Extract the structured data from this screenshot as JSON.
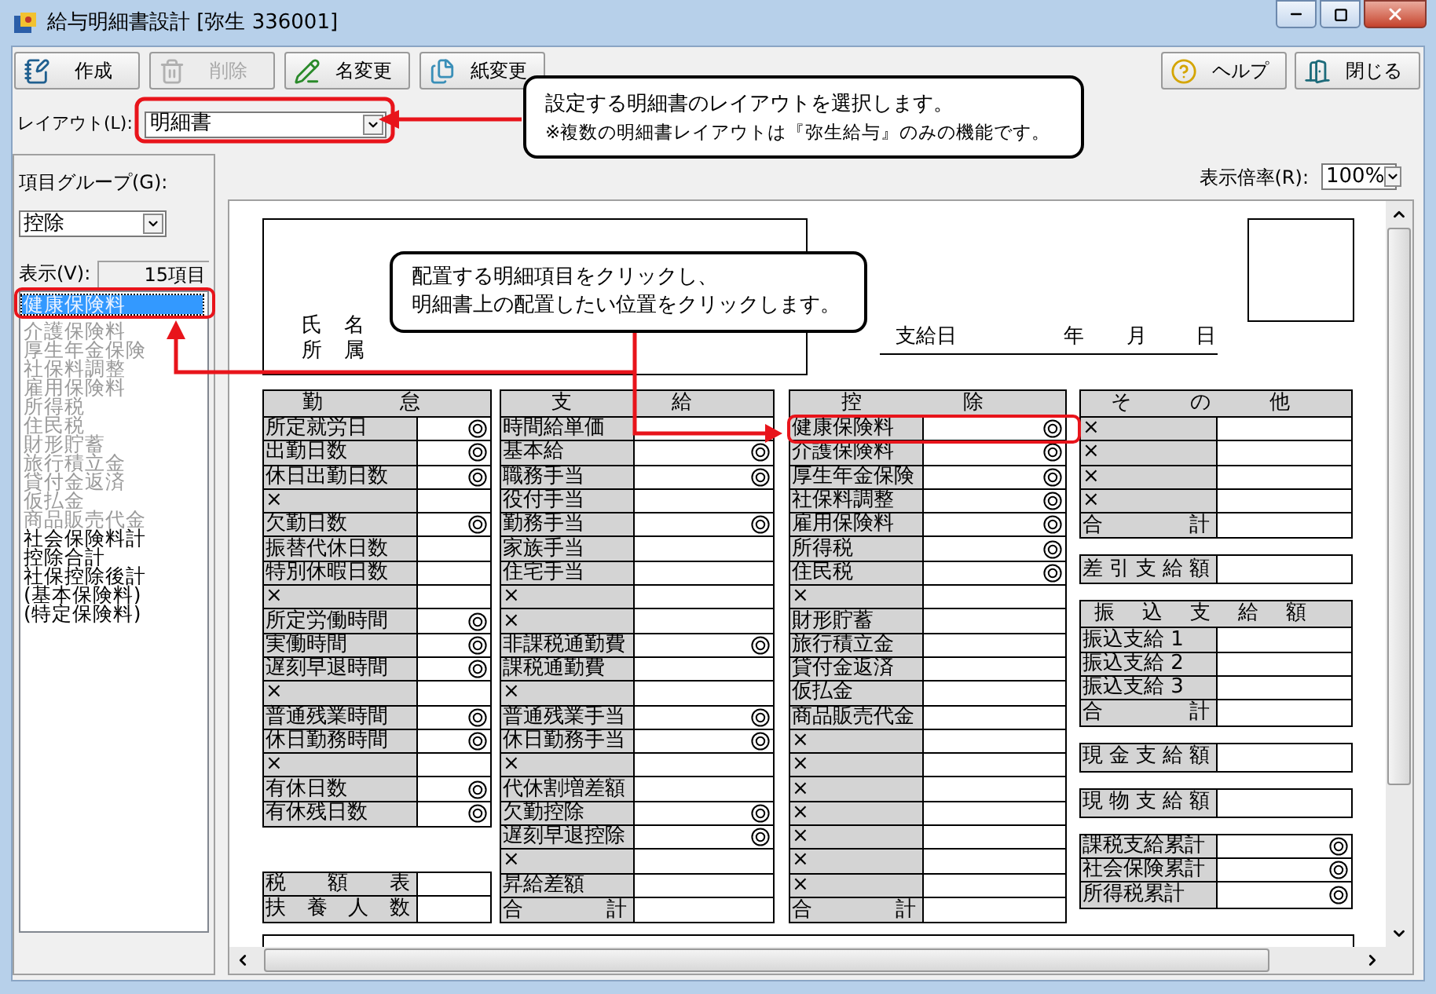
{
  "window": {
    "title": "給与明細書設計 [弥生 336001]"
  },
  "toolbar": {
    "left": [
      {
        "label": "作成",
        "disabled": false
      },
      {
        "label": "削除",
        "disabled": true
      },
      {
        "label": "名変更",
        "disabled": false
      },
      {
        "label": "紙変更",
        "disabled": false
      }
    ],
    "right": [
      {
        "label": "ヘルプ",
        "disabled": false
      },
      {
        "label": "閉じる",
        "disabled": false
      }
    ]
  },
  "layout": {
    "label": "レイアウト(L):",
    "value": "明細書"
  },
  "item_group": {
    "label": "項目グループ(G):",
    "value": "控除"
  },
  "view": {
    "label": "表示(V):",
    "count": "15項目"
  },
  "items": [
    {
      "label": "健康保険料",
      "selected": true,
      "placed": true
    },
    {
      "label": "介護保険料",
      "selected": false,
      "placed": true
    },
    {
      "label": "厚生年金保険",
      "selected": false,
      "placed": true
    },
    {
      "label": "社保料調整",
      "selected": false,
      "placed": true
    },
    {
      "label": "雇用保険料",
      "selected": false,
      "placed": true
    },
    {
      "label": "所得税",
      "selected": false,
      "placed": true
    },
    {
      "label": "住民税",
      "selected": false,
      "placed": true
    },
    {
      "label": "財形貯蓄",
      "selected": false,
      "placed": true
    },
    {
      "label": "旅行積立金",
      "selected": false,
      "placed": true
    },
    {
      "label": "貸付金返済",
      "selected": false,
      "placed": true
    },
    {
      "label": "仮払金",
      "selected": false,
      "placed": true
    },
    {
      "label": "商品販売代金",
      "selected": false,
      "placed": true
    },
    {
      "label": "社会保険料計",
      "selected": false,
      "placed": false
    },
    {
      "label": "控除合計",
      "selected": false,
      "placed": false
    },
    {
      "label": "社保控除後計",
      "selected": false,
      "placed": false
    },
    {
      "label": "(基本保険料)",
      "selected": false,
      "placed": false
    },
    {
      "label": "(特定保険料)",
      "selected": false,
      "placed": false
    }
  ],
  "zoom": {
    "label": "表示倍率(R):",
    "value": "100%"
  },
  "form": {
    "name_label": "氏 名",
    "dept_label": "所 属",
    "pay_date": {
      "label": "支給日",
      "year": "年",
      "month": "月",
      "day": "日"
    },
    "columns": [
      {
        "tables": [
          {
            "header": "勤 怠",
            "rows": [
              {
                "label": "所定就労日",
                "spread": false,
                "marked": true
              },
              {
                "label": "出勤日数",
                "spread": false,
                "marked": true
              },
              {
                "label": "休日出勤日数",
                "spread": false,
                "marked": true
              },
              {
                "label": "×",
                "spread": false,
                "marked": false
              },
              {
                "label": "欠勤日数",
                "spread": false,
                "marked": true
              },
              {
                "label": "振替代休日数",
                "spread": false,
                "marked": false
              },
              {
                "label": "特別休暇日数",
                "spread": false,
                "marked": false
              },
              {
                "label": "×",
                "spread": false,
                "marked": false
              },
              {
                "label": "所定労働時間",
                "spread": false,
                "marked": true
              },
              {
                "label": "実働時間",
                "spread": false,
                "marked": true
              },
              {
                "label": "遅刻早退時間",
                "spread": false,
                "marked": true
              },
              {
                "label": "×",
                "spread": false,
                "marked": false
              },
              {
                "label": "普通残業時間",
                "spread": false,
                "marked": true
              },
              {
                "label": "休日勤務時間",
                "spread": false,
                "marked": true
              },
              {
                "label": "×",
                "spread": false,
                "marked": false
              },
              {
                "label": "有休日数",
                "spread": false,
                "marked": true
              },
              {
                "label": "有休残日数",
                "spread": false,
                "marked": true
              }
            ]
          },
          {
            "rows": [
              {
                "label": "税 額 表",
                "spread": true,
                "marked": false
              },
              {
                "label": "扶 養 人 数",
                "spread": true,
                "marked": false
              }
            ]
          }
        ]
      },
      {
        "tables": [
          {
            "header": "支 給",
            "rows": [
              {
                "label": "時間給単価",
                "spread": false,
                "marked": false
              },
              {
                "label": "基本給",
                "spread": false,
                "marked": true
              },
              {
                "label": "職務手当",
                "spread": false,
                "marked": true
              },
              {
                "label": "役付手当",
                "spread": false,
                "marked": false
              },
              {
                "label": "勤務手当",
                "spread": false,
                "marked": true
              },
              {
                "label": "家族手当",
                "spread": false,
                "marked": false
              },
              {
                "label": "住宅手当",
                "spread": false,
                "marked": false
              },
              {
                "label": "×",
                "spread": false,
                "marked": false
              },
              {
                "label": "×",
                "spread": false,
                "marked": false
              },
              {
                "label": "非課税通勤費",
                "spread": false,
                "marked": true
              },
              {
                "label": "課税通勤費",
                "spread": false,
                "marked": false
              },
              {
                "label": "×",
                "spread": false,
                "marked": false
              },
              {
                "label": "普通残業手当",
                "spread": false,
                "marked": true
              },
              {
                "label": "休日勤務手当",
                "spread": false,
                "marked": true
              },
              {
                "label": "×",
                "spread": false,
                "marked": false
              },
              {
                "label": "代休割増差額",
                "spread": false,
                "marked": false
              },
              {
                "label": "欠勤控除",
                "spread": false,
                "marked": true
              },
              {
                "label": "遅刻早退控除",
                "spread": false,
                "marked": true
              },
              {
                "label": "×",
                "spread": false,
                "marked": false
              },
              {
                "label": "昇給差額",
                "spread": false,
                "marked": false
              },
              {
                "label": "合 計",
                "spread": true,
                "marked": false
              }
            ]
          }
        ]
      },
      {
        "tables": [
          {
            "header": "控 除",
            "rows": [
              {
                "label": "健康保険料",
                "spread": false,
                "marked": true
              },
              {
                "label": "介護保険料",
                "spread": false,
                "marked": true
              },
              {
                "label": "厚生年金保険",
                "spread": false,
                "marked": true
              },
              {
                "label": "社保料調整",
                "spread": false,
                "marked": true
              },
              {
                "label": "雇用保険料",
                "spread": false,
                "marked": true
              },
              {
                "label": "所得税",
                "spread": false,
                "marked": true
              },
              {
                "label": "住民税",
                "spread": false,
                "marked": true
              },
              {
                "label": "×",
                "spread": false,
                "marked": false
              },
              {
                "label": "財形貯蓄",
                "spread": false,
                "marked": false
              },
              {
                "label": "旅行積立金",
                "spread": false,
                "marked": false
              },
              {
                "label": "貸付金返済",
                "spread": false,
                "marked": false
              },
              {
                "label": "仮払金",
                "spread": false,
                "marked": false
              },
              {
                "label": "商品販売代金",
                "spread": false,
                "marked": false
              },
              {
                "label": "×",
                "spread": false,
                "marked": false
              },
              {
                "label": "×",
                "spread": false,
                "marked": false
              },
              {
                "label": "×",
                "spread": false,
                "marked": false
              },
              {
                "label": "×",
                "spread": false,
                "marked": false
              },
              {
                "label": "×",
                "spread": false,
                "marked": false
              },
              {
                "label": "×",
                "spread": false,
                "marked": false
              },
              {
                "label": "×",
                "spread": false,
                "marked": false
              },
              {
                "label": "合 計",
                "spread": true,
                "marked": false
              }
            ]
          }
        ]
      },
      {
        "tables": [
          {
            "header": "そ の 他",
            "rows": [
              {
                "label": "×",
                "spread": false,
                "marked": false
              },
              {
                "label": "×",
                "spread": false,
                "marked": false
              },
              {
                "label": "×",
                "spread": false,
                "marked": false
              },
              {
                "label": "×",
                "spread": false,
                "marked": false
              },
              {
                "label": "合 計",
                "spread": true,
                "marked": false
              }
            ]
          },
          {
            "rows": [
              {
                "label": "差 引 支 給 額",
                "spread": true,
                "marked": false
              }
            ]
          },
          {
            "header": "振 込 支 給 額",
            "rows": [
              {
                "label": "振込支給 1",
                "spread": false,
                "marked": false
              },
              {
                "label": "振込支給 2",
                "spread": false,
                "marked": false
              },
              {
                "label": "振込支給 3",
                "spread": false,
                "marked": false
              },
              {
                "label": "合 計",
                "spread": true,
                "marked": false
              }
            ]
          },
          {
            "rows": [
              {
                "label": "現 金 支 給 額",
                "spread": true,
                "marked": false
              }
            ]
          },
          {
            "rows": [
              {
                "label": "現 物 支 給 額",
                "spread": true,
                "marked": false
              }
            ]
          },
          {
            "rows": [
              {
                "label": "課税支給累計",
                "spread": false,
                "marked": true
              },
              {
                "label": "社会保険累計",
                "spread": false,
                "marked": true
              },
              {
                "label": "所得税累計",
                "spread": false,
                "marked": true
              }
            ]
          }
        ]
      }
    ]
  },
  "callouts": [
    {
      "lines": [
        {
          "text": "設定する明細書のレイアウトを選択します。",
          "kind": "main"
        },
        {
          "text": "※複数の明細書レイアウトは『弥生給与』のみの機能です。",
          "kind": "note"
        }
      ]
    },
    {
      "lines": [
        {
          "text": "配置する明細項目をクリックし、",
          "kind": "main"
        },
        {
          "text": "明細書上の配置したい位置をクリックします。",
          "kind": "main"
        }
      ]
    }
  ]
}
